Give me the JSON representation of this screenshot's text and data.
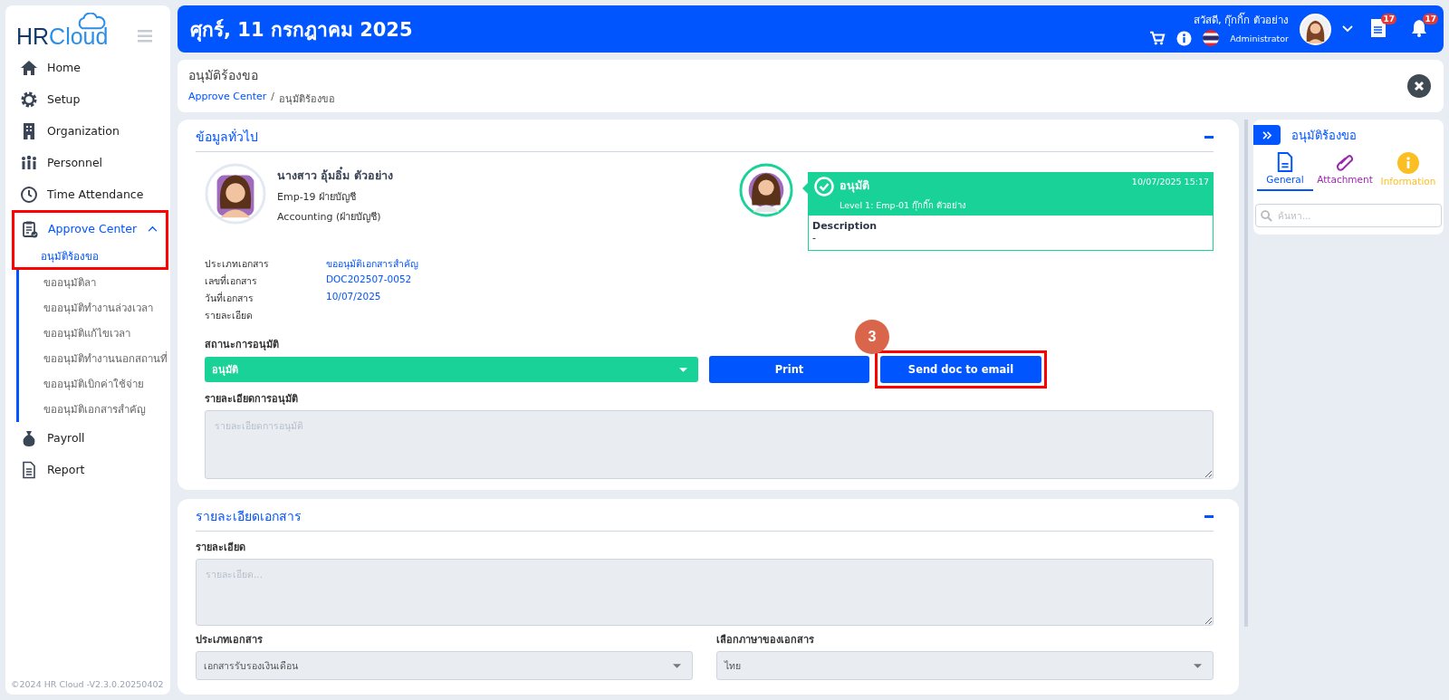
{
  "sidebar": {
    "logo_prefix": "HR",
    "logo_suffix": "Cloud",
    "menu": [
      {
        "label": "Home",
        "selected": false
      },
      {
        "label": "Setup",
        "selected": false
      },
      {
        "label": "Organization",
        "selected": false
      },
      {
        "label": "Personnel",
        "selected": false
      },
      {
        "label": "Time Attendance",
        "selected": false
      },
      {
        "label": "Approve Center",
        "selected": true,
        "expanded": true,
        "highlighted": true,
        "children": [
          {
            "label": "อนุมัติร้องขอ",
            "selected": true
          },
          {
            "label": "ขออนุมัติลา",
            "selected": false
          },
          {
            "label": "ขออนุมัติทำงานล่วงเวลา",
            "selected": false
          },
          {
            "label": "ขออนุมัติแก้ไขเวลา",
            "selected": false
          },
          {
            "label": "ขออนุมัติทำงานนอกสถานที่",
            "selected": false
          },
          {
            "label": "ขออนุมัติเบิกค่าใช้จ่าย",
            "selected": false
          },
          {
            "label": "ขออนุมัติเอกสารสำคัญ",
            "selected": false
          }
        ]
      },
      {
        "label": "Payroll",
        "selected": false
      },
      {
        "label": "Report",
        "selected": false
      }
    ],
    "footer": "©2024 HR Cloud -V2.3.0.20250402"
  },
  "header": {
    "date": "ศุกร์, 11 กรกฎาคม 2025",
    "greeting": "สวัสดี, กุ๊กกิ๊ก ตัวอย่าง",
    "role": "Administrator",
    "documents_badge": "17",
    "notifications_badge": "17"
  },
  "page": {
    "title": "อนุมัติร้องขอ",
    "breadcrumb": [
      "Approve Center",
      "อนุมัติร้องขอ"
    ],
    "breadcrumb_separator": "/"
  },
  "general": {
    "title": "ข้อมูลทั่วไป",
    "employee": {
      "name": "นางสาว อุ้มอิ๋ม ตัวอย่าง",
      "code": "Emp-19 ฝ่ายบัญชี",
      "department": "Accounting (ฝ่ายบัญชี)"
    },
    "approval": {
      "status": "อนุมัติ",
      "level": "Level 1: Emp-01 กุ๊กกิ๊ก ตัวอย่าง",
      "datetime": "10/07/2025 15:17",
      "description_label": "Description",
      "description": "-"
    },
    "doc_info": [
      {
        "label": "ประเภทเอกสาร",
        "value": "ขออนุมัติเอกสารสำคัญ"
      },
      {
        "label": "เลขที่เอกสาร",
        "value": "DOC202507-0052"
      },
      {
        "label": "วันที่เอกสาร",
        "value": "10/07/2025"
      },
      {
        "label": "รายละเอียด"
      }
    ],
    "status_label": "สถานะการอนุมัติ",
    "status_value": "อนุมัติ",
    "buttons": [
      {
        "label": "Print",
        "highlighted": false
      },
      {
        "label": "Send doc to email",
        "highlighted": true,
        "step": "3"
      }
    ],
    "detail_label": "รายละเอียดการอนุมัติ",
    "detail_placeholder": "รายละเอียดการอนุมัติ"
  },
  "document": {
    "title": "รายละเอียดเอกสาร",
    "detail_label": "รายละเอียด",
    "detail_placeholder": "รายละเอียด...",
    "type_label": "ประเภทเอกสาร",
    "type_value": "เอกสารรับรองเงินเดือน",
    "language_label": "เลือกภาษาของเอกสาร",
    "language_value": "ไทย"
  },
  "side_panel": {
    "title": "อนุมัติร้องขอ",
    "tabs": [
      {
        "label": "General",
        "selected": true,
        "color": "#0055ff"
      },
      {
        "label": "Attachment",
        "selected": false,
        "color": "#9c27b0"
      },
      {
        "label": "Information",
        "selected": false,
        "color": "#fbbf24"
      }
    ],
    "search_placeholder": "ค้นหา..."
  }
}
